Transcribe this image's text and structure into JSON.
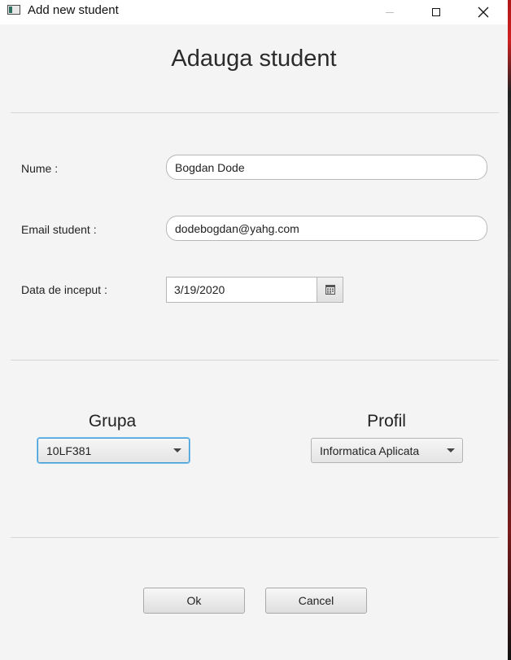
{
  "window": {
    "title": "Add new student",
    "controls": {
      "minimize_icon": "minimize-icon",
      "maximize_icon": "maximize-icon",
      "close_icon": "close-icon"
    }
  },
  "form": {
    "heading": "Adauga student",
    "name": {
      "label": "Nume :",
      "value": "Bogdan Dode"
    },
    "email": {
      "label": "Email student :",
      "value": "dodebogdan@yahg.com"
    },
    "start_date": {
      "label": "Data de inceput :",
      "value": "3/19/2020",
      "picker_icon": "calendar-icon"
    }
  },
  "selectors": {
    "group": {
      "label": "Grupa",
      "value": "10LF381"
    },
    "profile": {
      "label": "Profil",
      "value": "Informatica Aplicata"
    }
  },
  "buttons": {
    "ok": "Ok",
    "cancel": "Cancel"
  },
  "colors": {
    "focus_border": "#3e9ad6",
    "background": "#f4f4f4"
  }
}
